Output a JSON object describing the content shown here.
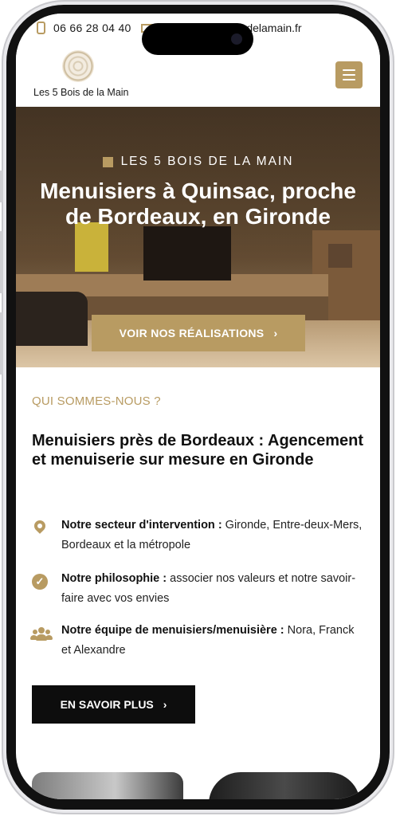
{
  "topbar": {
    "phone_icon": "phone-icon",
    "phone": "06 66 28 04 40",
    "mail_icon": "mail-icon",
    "email": "contact@les5boisdelamain.fr"
  },
  "header": {
    "logo_text": "Les 5 Bois de la Main",
    "menu_icon": "hamburger-icon"
  },
  "hero": {
    "label": "LES 5 BOIS DE LA MAIN",
    "title": "Menuisiers à Quinsac, proche de Bordeaux, en Gironde",
    "button": "VOIR NOS RÉALISATIONS",
    "button_icon": "chevron-right-icon"
  },
  "about": {
    "kicker": "QUI SOMMES-NOUS ?",
    "title": "Menuisiers près de Bordeaux : Agencement et menuiserie sur mesure en Gironde",
    "features": [
      {
        "icon": "location-pin-icon",
        "label": "Notre secteur d'intervention :",
        "text": " Gironde, Entre-deux-Mers, Bordeaux et la métropole"
      },
      {
        "icon": "check-circle-icon",
        "label": "Notre philosophie :",
        "text": " associer nos valeurs et notre savoir-faire avec vos envies"
      },
      {
        "icon": "team-icon",
        "label": "Notre équipe de menuisiers/menuisière :",
        "text": " Nora, Franck et Alexandre"
      }
    ],
    "button": "EN SAVOIR PLUS",
    "button_icon": "chevron-right-icon"
  },
  "colors": {
    "accent": "#b89b62",
    "dark": "#0d0d0d"
  }
}
